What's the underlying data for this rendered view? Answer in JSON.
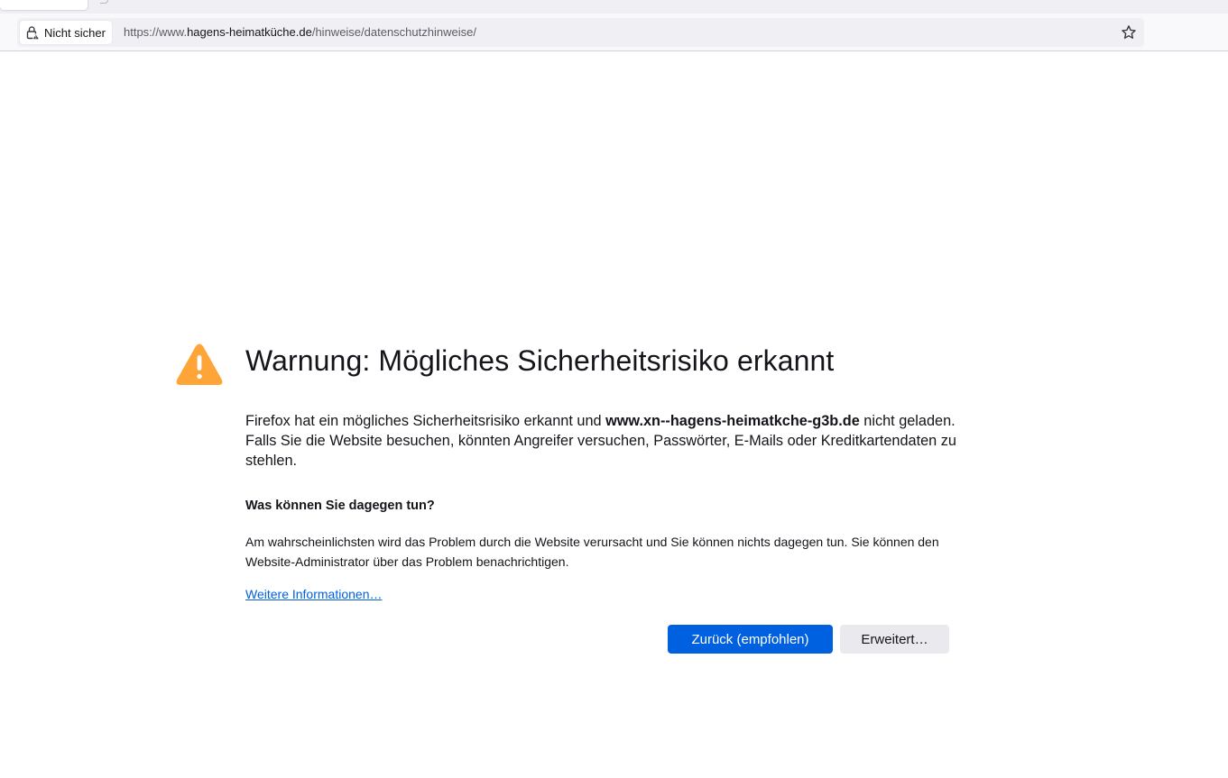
{
  "browser": {
    "identity_label": "Nicht sicher",
    "url": {
      "prefix": "https://www.",
      "host": "hagens-heimatküche.de",
      "path": "/hinweise/datenschutzhinweise/"
    },
    "icons": {
      "identity": "insecure-lock-icon",
      "bookmark": "star-icon"
    }
  },
  "error_page": {
    "icon": "warning-icon",
    "title": "Warnung: Mögliches Sicherheitsrisiko erkannt",
    "intro": {
      "before": "Firefox hat ein mögliches Sicherheitsrisiko erkannt und ",
      "domain": "www.xn--hagens-heimatkche-g3b.de",
      "after": " nicht geladen. Falls Sie die Website besuchen, könnten Angreifer versuchen, Passwörter, E-Mails oder Kreditkartendaten zu stehlen."
    },
    "what_to_do_heading": "Was können Sie dagegen tun?",
    "what_to_do_text": "Am wahrscheinlichsten wird das Problem durch die Website verursacht und Sie können nichts dagegen tun. Sie können den Website-Administrator über das Problem benachrichtigen.",
    "learn_more_link": "Weitere Informationen…",
    "buttons": {
      "go_back": "Zurück (empfohlen)",
      "advanced": "Erweitert…"
    }
  },
  "colors": {
    "warning": "#ffa436",
    "primary_button": "#0061e0",
    "link": "#0060df"
  }
}
